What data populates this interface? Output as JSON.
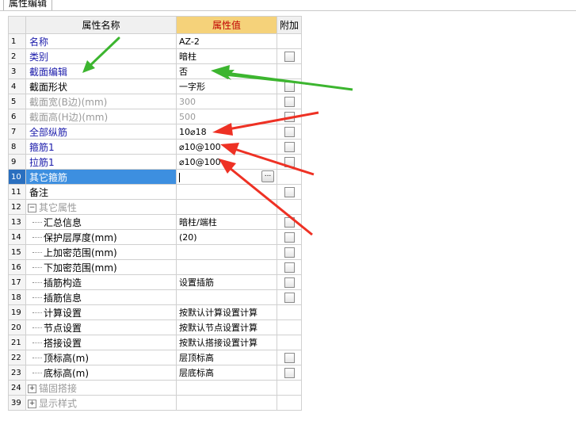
{
  "window": {
    "tab_label": "属性编辑"
  },
  "columns": {
    "name": "属性名称",
    "value": "属性值",
    "extra": "附加"
  },
  "rows": [
    {
      "num": "1",
      "name": "名称",
      "value": "AZ-2",
      "style": "blue",
      "checkbox": false,
      "indent": 0
    },
    {
      "num": "2",
      "name": "类别",
      "value": "暗柱",
      "style": "blue",
      "checkbox": true,
      "indent": 0
    },
    {
      "num": "3",
      "name": "截面编辑",
      "value": "否",
      "style": "blue",
      "checkbox": false,
      "indent": 0
    },
    {
      "num": "4",
      "name": "截面形状",
      "value": "一字形",
      "style": "normal",
      "checkbox": true,
      "indent": 0
    },
    {
      "num": "5",
      "name": "截面宽(B边)(mm)",
      "value": "300",
      "style": "gray",
      "checkbox": true,
      "indent": 0
    },
    {
      "num": "6",
      "name": "截面高(H边)(mm)",
      "value": "500",
      "style": "gray",
      "checkbox": true,
      "indent": 0
    },
    {
      "num": "7",
      "name": "全部纵筋",
      "value": "10⌀18",
      "style": "blue",
      "checkbox": true,
      "indent": 0
    },
    {
      "num": "8",
      "name": "箍筋1",
      "value": "⌀10@100",
      "style": "blue",
      "checkbox": true,
      "indent": 0
    },
    {
      "num": "9",
      "name": "拉筋1",
      "value": "⌀10@100",
      "style": "blue",
      "checkbox": true,
      "indent": 0
    },
    {
      "num": "10",
      "name": "其它箍筋",
      "value": "",
      "style": "selected",
      "checkbox": false,
      "indent": 0
    },
    {
      "num": "11",
      "name": "备注",
      "value": "",
      "style": "normal",
      "checkbox": true,
      "indent": 0
    },
    {
      "num": "12",
      "name": "其它属性",
      "value": "",
      "style": "group-open",
      "checkbox": false,
      "indent": 0
    },
    {
      "num": "13",
      "name": "汇总信息",
      "value": "暗柱/端柱",
      "style": "child",
      "checkbox": true,
      "indent": 1
    },
    {
      "num": "14",
      "name": "保护层厚度(mm)",
      "value": "(20)",
      "style": "child",
      "checkbox": true,
      "indent": 1
    },
    {
      "num": "15",
      "name": "上加密范围(mm)",
      "value": "",
      "style": "child",
      "checkbox": true,
      "indent": 1
    },
    {
      "num": "16",
      "name": "下加密范围(mm)",
      "value": "",
      "style": "child",
      "checkbox": true,
      "indent": 1
    },
    {
      "num": "17",
      "name": "插筋构造",
      "value": "设置插筋",
      "style": "child",
      "checkbox": true,
      "indent": 1
    },
    {
      "num": "18",
      "name": "插筋信息",
      "value": "",
      "style": "child",
      "checkbox": true,
      "indent": 1
    },
    {
      "num": "19",
      "name": "计算设置",
      "value": "按默认计算设置计算",
      "style": "child",
      "checkbox": false,
      "indent": 1
    },
    {
      "num": "20",
      "name": "节点设置",
      "value": "按默认节点设置计算",
      "style": "child",
      "checkbox": false,
      "indent": 1
    },
    {
      "num": "21",
      "name": "搭接设置",
      "value": "按默认搭接设置计算",
      "style": "child",
      "checkbox": false,
      "indent": 1
    },
    {
      "num": "22",
      "name": "顶标高(m)",
      "value": "层顶标高",
      "style": "child",
      "checkbox": true,
      "indent": 1
    },
    {
      "num": "23",
      "name": "底标高(m)",
      "value": "层底标高",
      "style": "child",
      "checkbox": true,
      "indent": 1
    },
    {
      "num": "24",
      "name": "锚固搭接",
      "value": "",
      "style": "group-closed",
      "checkbox": false,
      "indent": 0
    },
    {
      "num": "39",
      "name": "显示样式",
      "value": "",
      "style": "group-closed",
      "checkbox": false,
      "indent": 0
    }
  ],
  "editor": {
    "ellipsis_label": "..."
  },
  "icons": {
    "expand_collapse": "minus-box-icon",
    "expand_open": "plus-box-icon",
    "ellipsis": "ellipsis-button-icon"
  },
  "colors": {
    "blue_label": "#1a1aaa",
    "gray_label": "#9a9a9a",
    "value_header_bg": "#f5d27a",
    "value_header_text": "#c00000",
    "selected_row": "#3d8fe0",
    "arrow_green": "#3cb52f",
    "arrow_red": "#ee3124"
  }
}
